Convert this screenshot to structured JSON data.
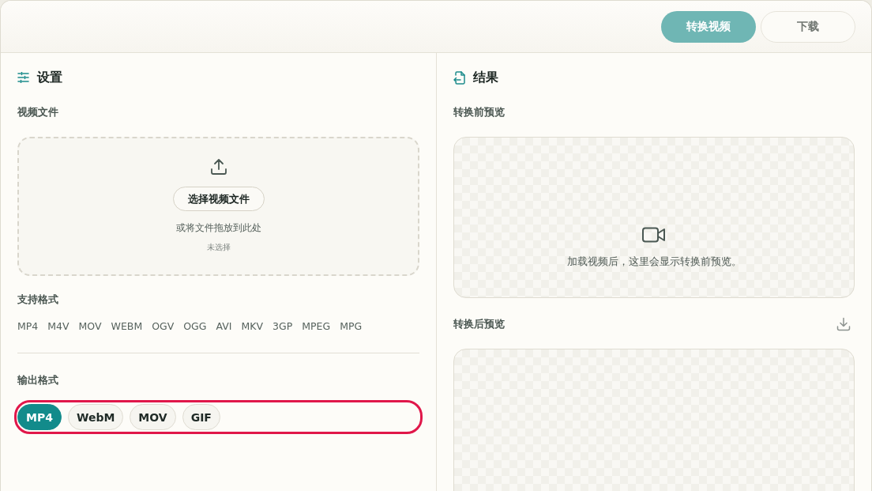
{
  "toolbar": {
    "buttons": [
      {
        "label": "转换视频",
        "kind": "primary",
        "disabled": true
      },
      {
        "label": "下载",
        "kind": "secondary",
        "disabled": true
      }
    ]
  },
  "settings": {
    "title": "设置",
    "video_file": {
      "label": "视频文件",
      "dropzone": {
        "button": "选择视频文件",
        "hint": "或将文件拖放到此处",
        "status": "未选择"
      }
    },
    "supported_formats": {
      "label": "支持格式",
      "formats": [
        "MP4",
        "M4V",
        "MOV",
        "WEBM",
        "OGV",
        "OGG",
        "AVI",
        "MKV",
        "3GP",
        "MPEG",
        "MPG"
      ]
    },
    "output_format": {
      "label": "输出格式",
      "highlighted": true,
      "options": [
        {
          "label": "MP4",
          "selected": true
        },
        {
          "label": "WebM",
          "selected": false
        },
        {
          "label": "MOV",
          "selected": false
        },
        {
          "label": "GIF",
          "selected": false
        }
      ]
    }
  },
  "results": {
    "title": "结果",
    "before_preview": {
      "label": "转换前预览",
      "message": "加载视频后，这里会显示转换前预览。"
    },
    "after_preview": {
      "label": "转换后预览"
    }
  }
}
